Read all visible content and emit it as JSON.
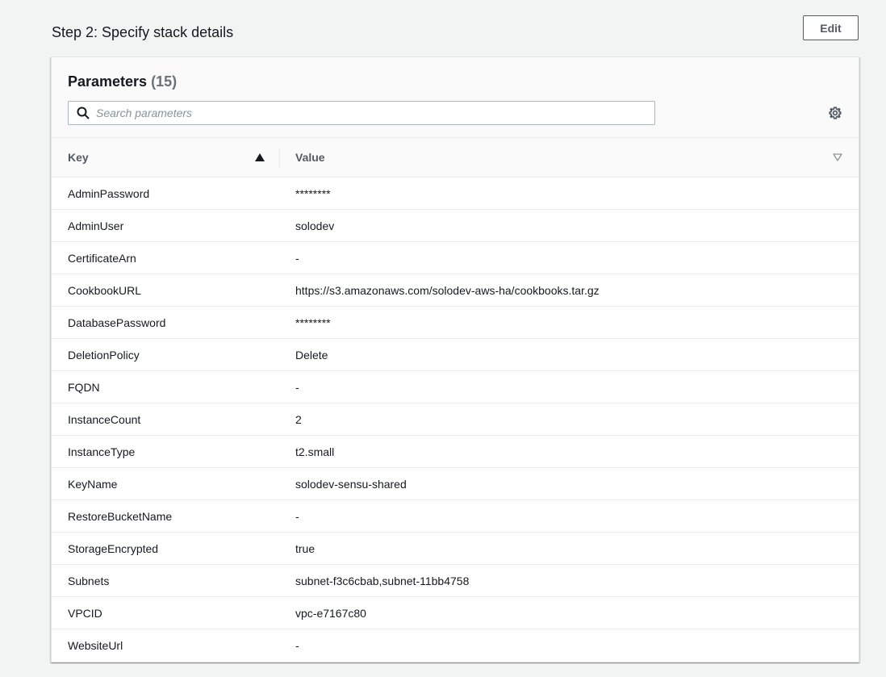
{
  "step": {
    "title": "Step 2: Specify stack details",
    "edit_label": "Edit"
  },
  "parameters": {
    "title": "Parameters",
    "count": "(15)",
    "search_placeholder": "Search parameters",
    "columns": {
      "key": "Key",
      "value": "Value"
    },
    "rows": [
      {
        "key": "AdminPassword",
        "value": "********"
      },
      {
        "key": "AdminUser",
        "value": "solodev"
      },
      {
        "key": "CertificateArn",
        "value": "-"
      },
      {
        "key": "CookbookURL",
        "value": "https://s3.amazonaws.com/solodev-aws-ha/cookbooks.tar.gz"
      },
      {
        "key": "DatabasePassword",
        "value": "********"
      },
      {
        "key": "DeletionPolicy",
        "value": "Delete"
      },
      {
        "key": "FQDN",
        "value": "-"
      },
      {
        "key": "InstanceCount",
        "value": "2"
      },
      {
        "key": "InstanceType",
        "value": "t2.small"
      },
      {
        "key": "KeyName",
        "value": "solodev-sensu-shared"
      },
      {
        "key": "RestoreBucketName",
        "value": "-"
      },
      {
        "key": "StorageEncrypted",
        "value": "true"
      },
      {
        "key": "Subnets",
        "value": "subnet-f3c6cbab,subnet-11bb4758"
      },
      {
        "key": "VPCID",
        "value": "vpc-e7167c80"
      },
      {
        "key": "WebsiteUrl",
        "value": "-"
      }
    ]
  },
  "icons": {
    "search": "search-icon",
    "settings": "gear-icon",
    "sort_key": "sort-ascending-icon",
    "sort_value": "sort-none-icon"
  },
  "colors": {
    "text": "#16191f",
    "muted": "#545b64",
    "border": "#eaeded",
    "background": "#f2f3f3"
  }
}
